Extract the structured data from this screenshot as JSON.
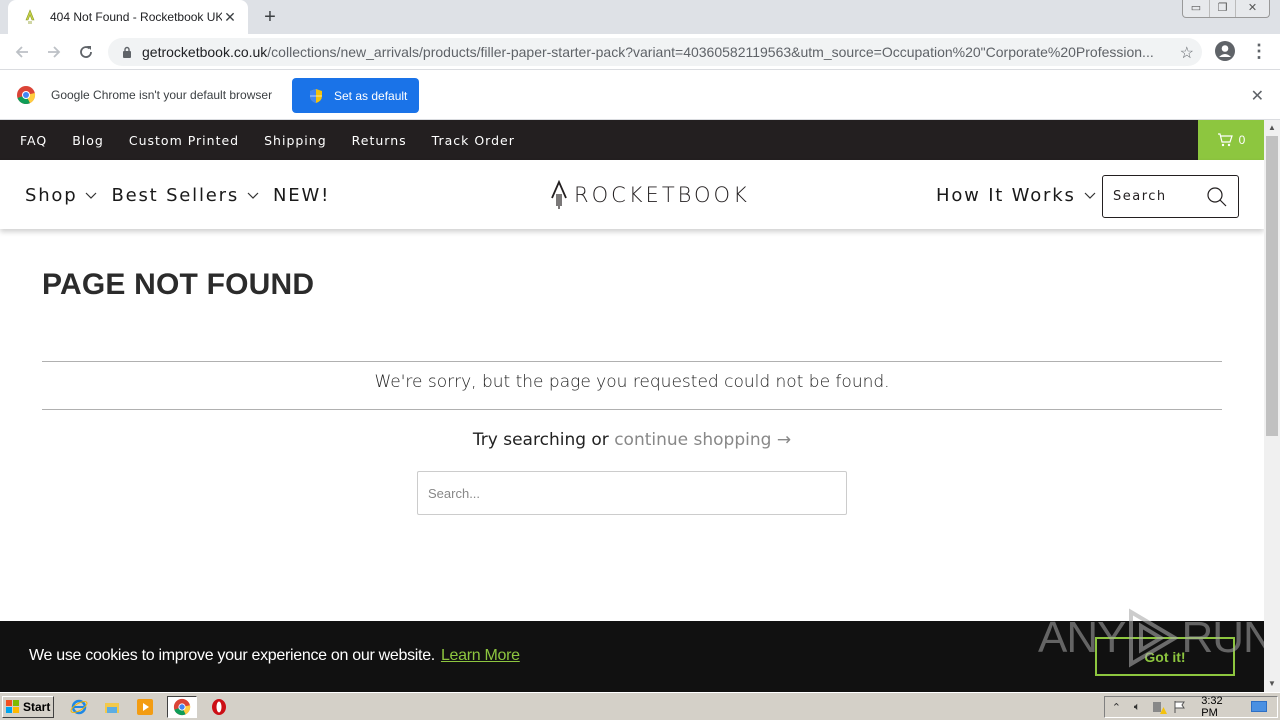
{
  "browser": {
    "tab": {
      "title": "404 Not Found - Rocketbook UK",
      "favicon": "rocket-icon"
    },
    "url_host": "getrocketbook.co.uk",
    "url_path": "/collections/new_arrivals/products/filler-paper-starter-pack?variant=40360582119563&utm_source=Occupation%20\"Corporate%20Profession...",
    "infobar": {
      "message": "Google Chrome isn't your default browser",
      "button_label": "Set as default"
    }
  },
  "site": {
    "utility_nav": [
      "FAQ",
      "Blog",
      "Custom Printed",
      "Shipping",
      "Returns",
      "Track Order"
    ],
    "cart_count": "0",
    "main_nav_left": [
      {
        "label": "Shop",
        "has_dropdown": true
      },
      {
        "label": "Best Sellers",
        "has_dropdown": true
      },
      {
        "label": "NEW!",
        "has_dropdown": false
      }
    ],
    "logo_text": "ROCKETBOOK",
    "main_nav_right": [
      {
        "label": "How It Works",
        "has_dropdown": true
      }
    ],
    "header_search_placeholder": "Search",
    "accent_color": "#8dc63f"
  },
  "page": {
    "title": "PAGE NOT FOUND",
    "sorry_message": "We're sorry, but the page you requested could not be found.",
    "try_prefix": "Try searching or ",
    "continue_link": "continue shopping →",
    "search_placeholder": "Search..."
  },
  "cookie_banner": {
    "message": "We use cookies to improve your experience on our website.",
    "learn_more": "Learn More",
    "accept_label": "Got it!"
  },
  "watermark": {
    "left": "ANY",
    "right": "RUN"
  },
  "taskbar": {
    "start_label": "Start",
    "apps": [
      "internet-explorer-icon",
      "file-explorer-icon",
      "media-player-icon",
      "chrome-icon",
      "opera-icon"
    ],
    "clock": "3:32 PM"
  }
}
